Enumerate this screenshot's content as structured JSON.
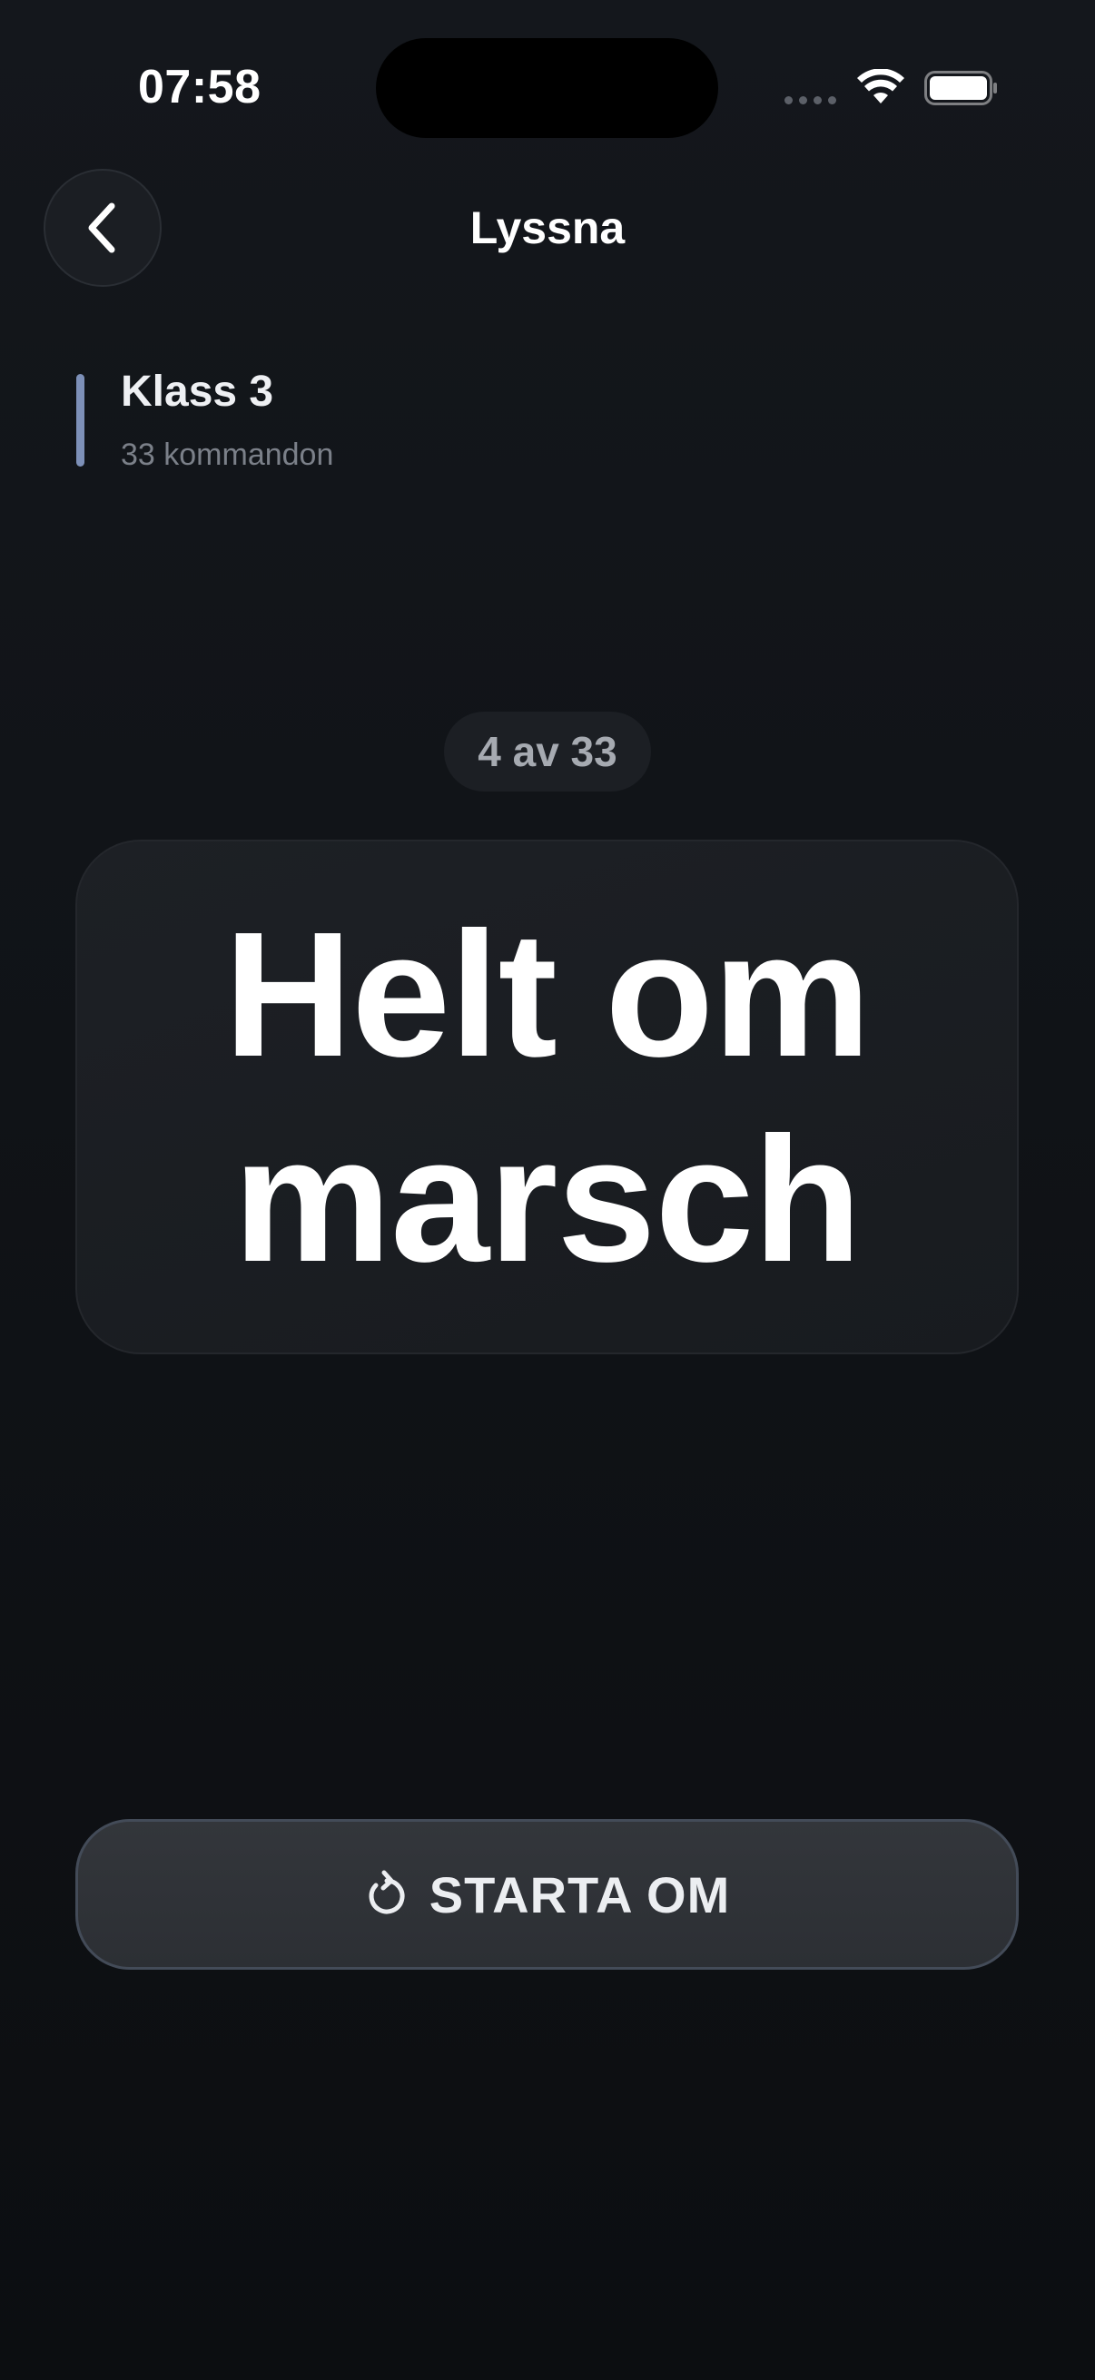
{
  "status_bar": {
    "time": "07:58",
    "icons": [
      "signal-dots-icon",
      "wifi-icon",
      "battery-icon"
    ]
  },
  "nav": {
    "title": "Lyssna",
    "back_icon": "chevron-left-icon"
  },
  "class_info": {
    "title": "Klass 3",
    "subtitle": "33 kommandon",
    "accent_color": "#7d90b8"
  },
  "progress": {
    "label": "4 av 33",
    "current": 4,
    "total": 33
  },
  "command": {
    "text": "Helt om marsch"
  },
  "restart_button": {
    "label": "STARTA OM",
    "icon": "restart-icon"
  },
  "colors": {
    "background": "#101317",
    "card": "#1b1e23",
    "text": "#ffffff"
  }
}
